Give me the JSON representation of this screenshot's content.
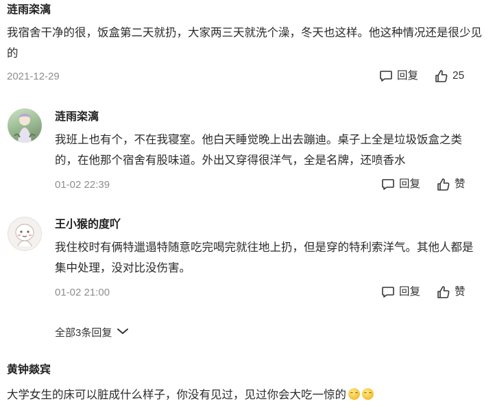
{
  "comments": [
    {
      "author": "涟雨栥漓",
      "text": "我宿舍干净的很，饭盒第二天就扔，大家两三天就洗个澡，冬天也这样。他这种情况还是很少见的",
      "date": "2021-12-29",
      "reply_label": "回复",
      "like_label": "25"
    },
    {
      "author": "涟雨栥漓",
      "text": "我班上也有个，不在我寝室。他白天睡觉晚上出去蹦迪。桌子上全是垃圾饭盒之类的，在他那个宿舍有股味道。外出又穿得很洋气，全是名牌，还喷香水",
      "date": "01-02 22:39",
      "reply_label": "回复",
      "like_label": "赞"
    },
    {
      "author": "王小猴的度吖",
      "text": "我住校时有俩特邋遢特随意吃完喝完就往地上扔，但是穿的特利索洋气。其他人都是集中处理，没对比没伤害。",
      "date": "01-02 21:00",
      "reply_label": "回复",
      "like_label": "赞"
    },
    {
      "author": "黄钟燚宾",
      "text": "大学女生的床可以脏成什么样子，你没有见过，见过你会大吃一惊的"
    }
  ],
  "expand_replies_label": "全部3条回复",
  "icons": {
    "reply": "comment-icon",
    "like": "thumbs-up-icon",
    "expand": "chevron-down-icon",
    "emoji": "smile-emoji-icon"
  }
}
